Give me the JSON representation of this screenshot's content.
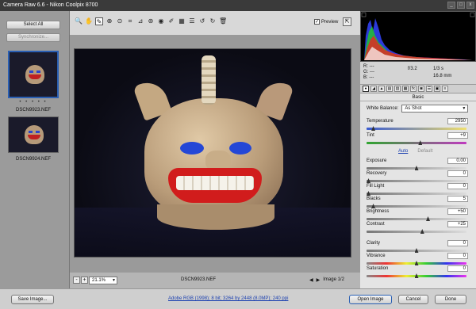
{
  "window": {
    "title": "Camera Raw 6.6  -  Nikon Coolpix 8700",
    "controls": [
      "_",
      "□",
      "x"
    ]
  },
  "filmstrip": {
    "select_all": "Select All",
    "synchronize": "Synchronize...",
    "rating_stars": "• • • • •",
    "files": [
      {
        "name": "DSCN9923.NEF",
        "selected": true
      },
      {
        "name": "DSCN9924.NEF",
        "selected": false
      }
    ]
  },
  "toolbar": {
    "tools": [
      {
        "name": "zoom-tool-icon",
        "glyph": "🔍"
      },
      {
        "name": "hand-tool-icon",
        "glyph": "✋"
      },
      {
        "name": "white-balance-tool-icon",
        "glyph": "✎"
      },
      {
        "name": "color-sampler-tool-icon",
        "glyph": "⊕"
      },
      {
        "name": "targeted-adjustment-tool-icon",
        "glyph": "⊙"
      },
      {
        "name": "crop-tool-icon",
        "glyph": "⌗"
      },
      {
        "name": "straighten-tool-icon",
        "glyph": "⊿"
      },
      {
        "name": "spot-removal-tool-icon",
        "glyph": "⊛"
      },
      {
        "name": "red-eye-tool-icon",
        "glyph": "◉"
      },
      {
        "name": "adjustment-brush-icon",
        "glyph": "✐"
      },
      {
        "name": "graduated-filter-icon",
        "glyph": "▦"
      },
      {
        "name": "preferences-icon",
        "glyph": "☰"
      },
      {
        "name": "rotate-ccw-icon",
        "glyph": "↺"
      },
      {
        "name": "rotate-cw-icon",
        "glyph": "↻"
      },
      {
        "name": "trash-icon",
        "glyph": "🗑"
      }
    ],
    "preview_label": "Preview",
    "preview_checked": "✓",
    "fullscreen_glyph": "⇱"
  },
  "image": {
    "zoom": "21.1%",
    "filename": "DSCN9923.NEF",
    "counter": "Image 1/2",
    "zoom_out": "-",
    "zoom_in": "+",
    "prev": "◀",
    "next": "▶"
  },
  "readout": {
    "r": "R:",
    "g": "G:",
    "b": "B:",
    "r_val": "---",
    "g_val": "---",
    "b_val": "---",
    "aperture": "f/3.2",
    "shutter": "1/3 s",
    "focal": "16.8 mm"
  },
  "panel": {
    "header": "Basic",
    "white_balance_label": "White Balance:",
    "white_balance_value": "As Shot",
    "auto": "Auto",
    "default": "Default",
    "sliders": [
      {
        "label": "Temperature",
        "value": "2950",
        "pos": 0.05,
        "kind": "temp"
      },
      {
        "label": "Tint",
        "value": "+9",
        "pos": 0.54,
        "kind": "tint"
      },
      {
        "label": "Exposure",
        "value": "0.00",
        "pos": 0.5,
        "kind": "gray"
      },
      {
        "label": "Recovery",
        "value": "0",
        "pos": 0.0,
        "kind": "gray"
      },
      {
        "label": "Fill Light",
        "value": "0",
        "pos": 0.0,
        "kind": "gray"
      },
      {
        "label": "Blacks",
        "value": "5",
        "pos": 0.05,
        "kind": "gray"
      },
      {
        "label": "Brightness",
        "value": "+50",
        "pos": 0.62,
        "kind": "gray"
      },
      {
        "label": "Contrast",
        "value": "+25",
        "pos": 0.56,
        "kind": "gray"
      },
      {
        "label": "Clarity",
        "value": "0",
        "pos": 0.5,
        "kind": "gray"
      },
      {
        "label": "Vibrance",
        "value": "0",
        "pos": 0.5,
        "kind": "sat"
      },
      {
        "label": "Saturation",
        "value": "0",
        "pos": 0.5,
        "kind": "sat"
      }
    ]
  },
  "bottombar": {
    "save": "Save Image...",
    "workflow": "Adobe RGB (1998); 8 bit; 3264 by 2448 (8.0MP); 240 ppi",
    "open": "Open Image",
    "cancel": "Cancel",
    "done": "Done"
  }
}
